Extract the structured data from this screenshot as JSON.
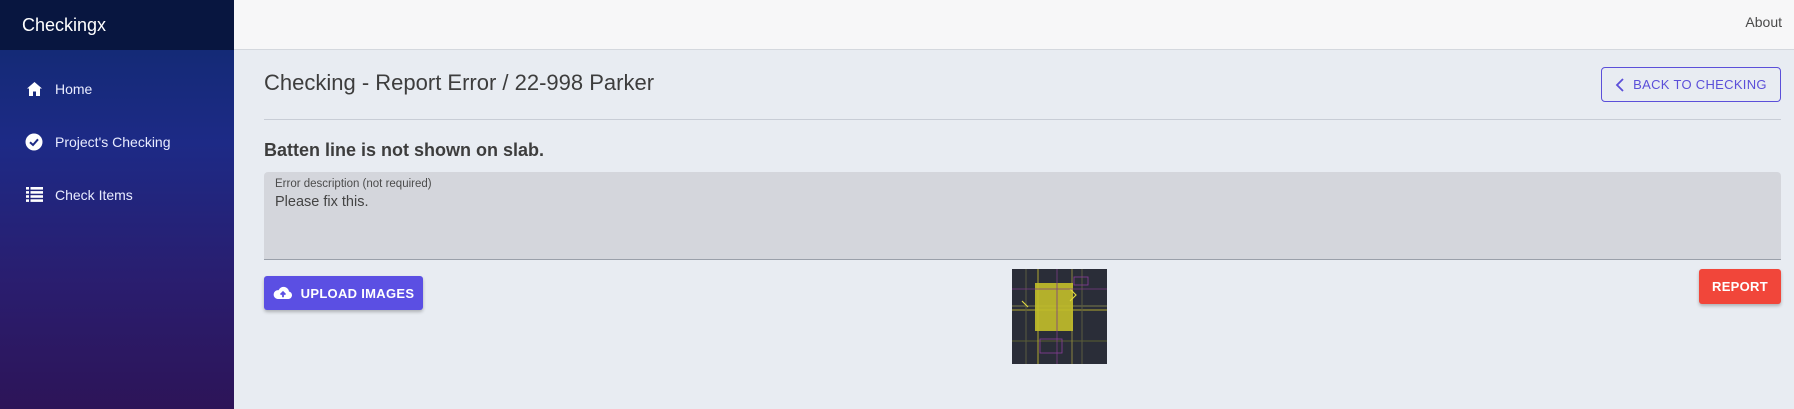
{
  "app": {
    "brand": "Checkingx"
  },
  "sidebar": {
    "items": [
      {
        "label": "Home",
        "icon": "home-icon"
      },
      {
        "label": "Project's Checking",
        "icon": "check-circle-icon"
      },
      {
        "label": "Check Items",
        "icon": "list-icon"
      }
    ]
  },
  "topbar": {
    "about": "About"
  },
  "page": {
    "title": "Checking - Report Error / 22-998 Parker",
    "back_label": "BACK TO CHECKING",
    "error_title": "Batten line is not shown on slab.",
    "description": {
      "label": "Error description (not required)",
      "value": "Please fix this."
    },
    "upload_label": "UPLOAD IMAGES",
    "report_label": "REPORT"
  },
  "colors": {
    "accent": "#5b4fe3",
    "danger": "#f1463a",
    "sidebar_top": "#0f2a6e",
    "sidebar_bottom": "#2d1458"
  }
}
